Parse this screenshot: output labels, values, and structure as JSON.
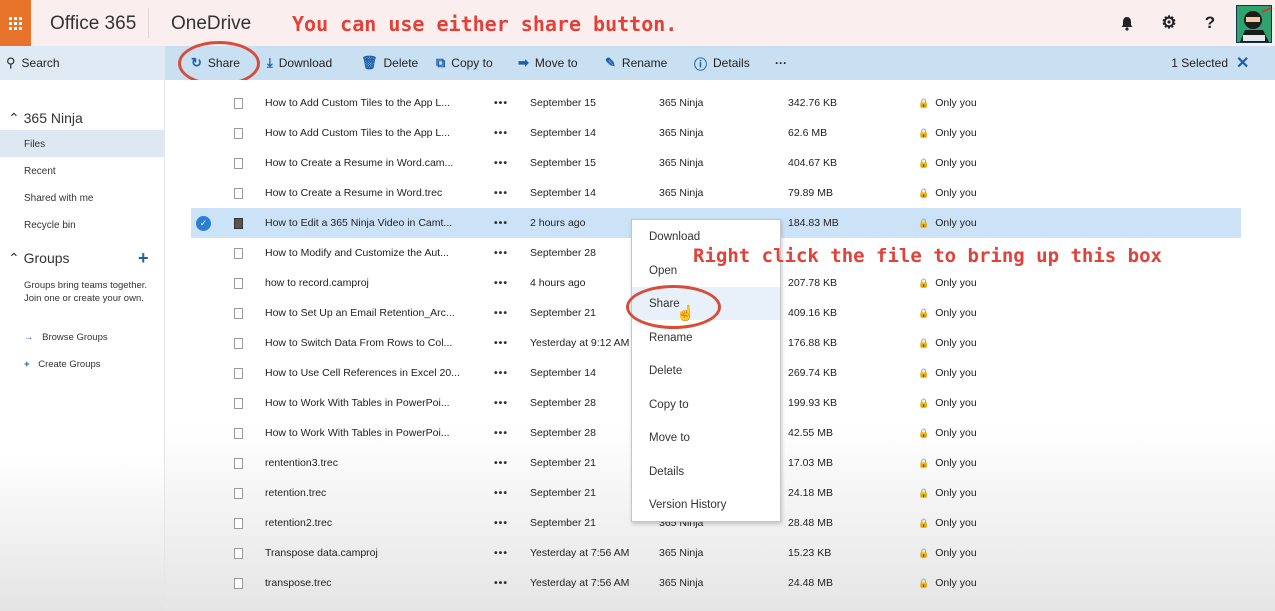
{
  "suite": {
    "title": "Office 365",
    "app_name": "OneDrive",
    "annotation_top": "You can use either share button.",
    "icons": [
      "bell-icon",
      "gear-icon",
      "help-icon"
    ]
  },
  "cmdbar": {
    "search_label": "Search",
    "share_label": "Share",
    "download_label": "Download",
    "delete_label": "Delete",
    "copy_label": "Copy to",
    "move_label": "Move to",
    "rename_label": "Rename",
    "details_label": "Details",
    "more_label": "···",
    "selected_label": "1 Selected",
    "close_label": "✕"
  },
  "nav": {
    "account": "365 Ninja",
    "items": [
      {
        "label": "Files"
      },
      {
        "label": "Recent"
      },
      {
        "label": "Shared with me"
      },
      {
        "label": "Recycle bin"
      }
    ],
    "groups_label": "Groups",
    "groups_desc": "Groups bring teams together. Join one or create your own.",
    "browse_groups": "Browse Groups",
    "create_groups": "Create Groups"
  },
  "files": [
    {
      "name": "How to Add Custom Tiles to the App L...",
      "more": "•••",
      "modified": "September 15",
      "by": "365 Ninja",
      "size": "342.76 KB",
      "sharing": "Only you"
    },
    {
      "name": "How to Add Custom Tiles to the App L...",
      "more": "•••",
      "modified": "September 14",
      "by": "365 Ninja",
      "size": "62.6 MB",
      "sharing": "Only you"
    },
    {
      "name": "How to Create a Resume in Word.cam...",
      "more": "•••",
      "modified": "September 15",
      "by": "365 Ninja",
      "size": "404.67 KB",
      "sharing": "Only you"
    },
    {
      "name": "How to Create a Resume in Word.trec",
      "more": "•••",
      "modified": "September 14",
      "by": "365 Ninja",
      "size": "79.89 MB",
      "sharing": "Only you"
    },
    {
      "name": "How to Edit a 365 Ninja Video in Camt...",
      "more": "•••",
      "modified": "2 hours ago",
      "by": "",
      "size": "184.83 MB",
      "sharing": "Only you",
      "selected": true
    },
    {
      "name": "How to Modify and Customize the Aut...",
      "more": "•••",
      "modified": "September 28",
      "by": "",
      "size": "",
      "sharing": ""
    },
    {
      "name": "how to record.camproj",
      "more": "•••",
      "modified": "4 hours ago",
      "by": "",
      "size": "207.78 KB",
      "sharing": "Only you"
    },
    {
      "name": "How to Set Up an Email Retention_Arc...",
      "more": "•••",
      "modified": "September 21",
      "by": "",
      "size": "409.16 KB",
      "sharing": "Only you"
    },
    {
      "name": "How to Switch Data From Rows to Col...",
      "more": "•••",
      "modified": "Yesterday at 9:12 AM",
      "by": "",
      "size": "176.88 KB",
      "sharing": "Only you"
    },
    {
      "name": "How to Use Cell References in Excel 20...",
      "more": "•••",
      "modified": "September 14",
      "by": "",
      "size": "269.74 KB",
      "sharing": "Only you"
    },
    {
      "name": "How to Work With Tables in PowerPoi...",
      "more": "•••",
      "modified": "September 28",
      "by": "",
      "size": "199.93 KB",
      "sharing": "Only you"
    },
    {
      "name": "How to Work With Tables in PowerPoi...",
      "more": "•••",
      "modified": "September 28",
      "by": "",
      "size": "42.55 MB",
      "sharing": "Only you"
    },
    {
      "name": "rentention3.trec",
      "more": "•••",
      "modified": "September 21",
      "by": "",
      "size": "17.03 MB",
      "sharing": "Only you"
    },
    {
      "name": "retention.trec",
      "more": "•••",
      "modified": "September 21",
      "by": "",
      "size": "24.18 MB",
      "sharing": "Only you"
    },
    {
      "name": "retention2.trec",
      "more": "•••",
      "modified": "September 21",
      "by": "365 Ninja",
      "size": "28.48 MB",
      "sharing": "Only you"
    },
    {
      "name": "Transpose data.camproj",
      "more": "•••",
      "modified": "Yesterday at 7:56 AM",
      "by": "365 Ninja",
      "size": "15.23 KB",
      "sharing": "Only you"
    },
    {
      "name": "transpose.trec",
      "more": "•••",
      "modified": "Yesterday at 7:56 AM",
      "by": "365 Ninja",
      "size": "24.48 MB",
      "sharing": "Only you"
    }
  ],
  "context_menu": {
    "annotation": "Right click the file to bring up this box",
    "items": [
      {
        "label": "Download"
      },
      {
        "label": "Open"
      },
      {
        "label": "Share"
      },
      {
        "label": "Rename"
      },
      {
        "label": "Delete"
      },
      {
        "label": "Copy to"
      },
      {
        "label": "Move to"
      },
      {
        "label": "Details"
      },
      {
        "label": "Version History"
      }
    ]
  },
  "colors": {
    "accent": "#1e5fa8",
    "annotation_red": "#e2413a",
    "waffle_orange": "#e8742b",
    "selected_row": "#cce3f7"
  }
}
